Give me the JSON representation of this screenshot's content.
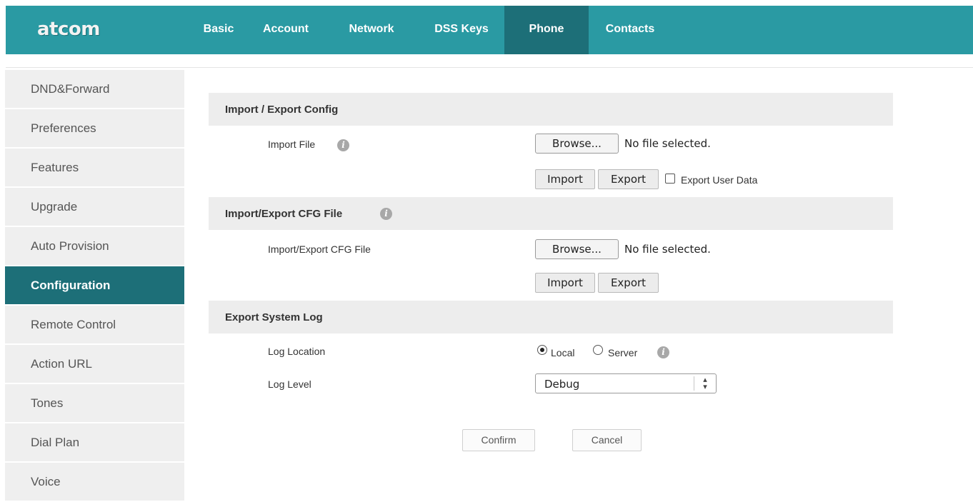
{
  "brand": {
    "logo": "atcom"
  },
  "nav": {
    "tabs": [
      {
        "label": "Basic",
        "active": false
      },
      {
        "label": "Account",
        "active": false
      },
      {
        "label": "Network",
        "active": false
      },
      {
        "label": "DSS Keys",
        "active": false
      },
      {
        "label": "Phone",
        "active": true
      },
      {
        "label": "Contacts",
        "active": false
      }
    ]
  },
  "sidebar": {
    "items": [
      {
        "label": "DND&Forward",
        "active": false
      },
      {
        "label": "Preferences",
        "active": false
      },
      {
        "label": "Features",
        "active": false
      },
      {
        "label": "Upgrade",
        "active": false
      },
      {
        "label": "Auto Provision",
        "active": false
      },
      {
        "label": "Configuration",
        "active": true
      },
      {
        "label": "Remote Control",
        "active": false
      },
      {
        "label": "Action URL",
        "active": false
      },
      {
        "label": "Tones",
        "active": false
      },
      {
        "label": "Dial Plan",
        "active": false
      },
      {
        "label": "Voice",
        "active": false
      }
    ]
  },
  "import_export_config": {
    "title": "Import / Export Config",
    "import_file_label": "Import File",
    "browse_label": "Browse...",
    "no_file": "No file selected.",
    "import_label": "Import",
    "export_label": "Export",
    "export_user_data_label": "Export User Data",
    "export_user_data_checked": false
  },
  "cfg_file": {
    "title": "Import/Export CFG File",
    "row_label": "Import/Export CFG File",
    "browse_label": "Browse...",
    "no_file": "No file selected.",
    "import_label": "Import",
    "export_label": "Export"
  },
  "system_log": {
    "title": "Export System Log",
    "location_label": "Log Location",
    "location_options": [
      "Local",
      "Server"
    ],
    "location_selected": "Local",
    "level_label": "Log Level",
    "level_value": "Debug"
  },
  "actions": {
    "confirm": "Confirm",
    "cancel": "Cancel"
  },
  "colors": {
    "header": "#2a9aa3",
    "active": "#1d6f78",
    "section_bg": "#ededed",
    "sidebar_bg": "#efefef"
  }
}
